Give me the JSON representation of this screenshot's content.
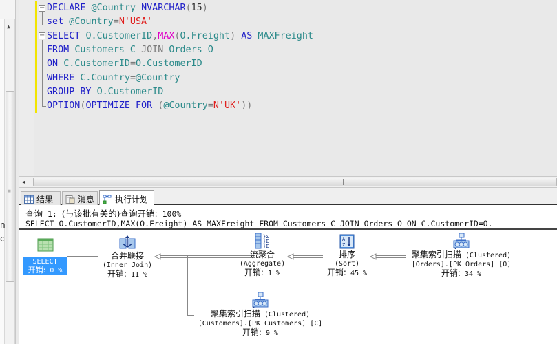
{
  "left_panel": {
    "partial_text_1": "n",
    "partial_text_2": "c"
  },
  "editor": {
    "lines": [
      {
        "tokens": [
          [
            "kw",
            "DECLARE "
          ],
          [
            "id",
            "@Country "
          ],
          [
            "kw",
            "NVARCHAR"
          ],
          [
            "gray",
            "("
          ],
          [
            "num",
            "15"
          ],
          [
            "gray",
            ")"
          ]
        ]
      },
      {
        "tokens": [
          [
            "kw",
            "set "
          ],
          [
            "id",
            "@Country"
          ],
          [
            "gray",
            "="
          ],
          [
            "str",
            "N'USA'"
          ]
        ]
      },
      {
        "tokens": [
          [
            "kw",
            "SELECT "
          ],
          [
            "id",
            "O.CustomerID"
          ],
          [
            "gray",
            ","
          ],
          [
            "fn",
            "MAX"
          ],
          [
            "gray",
            "("
          ],
          [
            "id",
            "O.Freight"
          ],
          [
            "gray",
            ") "
          ],
          [
            "kw",
            "AS "
          ],
          [
            "id",
            "MAXFreight"
          ]
        ]
      },
      {
        "tokens": [
          [
            "kw",
            "FROM "
          ],
          [
            "id",
            "Customers C "
          ],
          [
            "gray",
            "JOIN "
          ],
          [
            "id",
            "Orders O"
          ]
        ]
      },
      {
        "tokens": [
          [
            "kw",
            "ON "
          ],
          [
            "id",
            "C.CustomerID"
          ],
          [
            "gray",
            "="
          ],
          [
            "id",
            "O.CustomerID"
          ]
        ]
      },
      {
        "tokens": [
          [
            "kw",
            "WHERE "
          ],
          [
            "id",
            "C.Country"
          ],
          [
            "gray",
            "="
          ],
          [
            "id",
            "@Country"
          ]
        ]
      },
      {
        "tokens": [
          [
            "kw",
            "GROUP BY "
          ],
          [
            "id",
            "O.CustomerID"
          ]
        ]
      },
      {
        "tokens": [
          [
            "kw",
            "OPTION"
          ],
          [
            "gray",
            "("
          ],
          [
            "kw",
            "OPTIMIZE FOR "
          ],
          [
            "gray",
            "("
          ],
          [
            "id",
            "@Country"
          ],
          [
            "gray",
            "="
          ],
          [
            "str",
            "N'UK'"
          ],
          [
            "gray",
            "))"
          ]
        ]
      }
    ]
  },
  "tabs": [
    {
      "label": "结果",
      "icon": "grid-icon"
    },
    {
      "label": "消息",
      "icon": "message-icon"
    },
    {
      "label": "执行计划",
      "icon": "execution-plan-icon",
      "active": true
    }
  ],
  "plan": {
    "header_cn_1": "查询",
    "header_num": " 1: ",
    "header_cn_2": "(与该批有关的)查询开销:",
    "header_pct": " 100%",
    "query_text": "SELECT O.CustomerID,MAX(O.Freight) AS MAXFreight FROM Customers C JOIN Orders O ON C.CustomerID=O.",
    "cost_label": "开销:",
    "nodes": {
      "select": {
        "name": "SELECT",
        "cost": " 0 %"
      },
      "merge_join": {
        "name": "合并联接",
        "sub": "(Inner Join)",
        "cost": " 11 %"
      },
      "aggregate": {
        "name": "流聚合",
        "sub": "(Aggregate)",
        "cost": " 1 %"
      },
      "sort": {
        "name": "排序",
        "sub": "(Sort)",
        "cost": " 45 %"
      },
      "orders_scan": {
        "name": "聚集索引扫描",
        "sub": " (Clustered)",
        "object": "[Orders].[PK_Orders] [O]",
        "cost": " 34 %"
      },
      "customers_scan": {
        "name": "聚集索引扫描",
        "sub": " (Clustered)",
        "object": "[Customers].[PK_Customers] [C]",
        "cost": " 9 %"
      }
    }
  }
}
